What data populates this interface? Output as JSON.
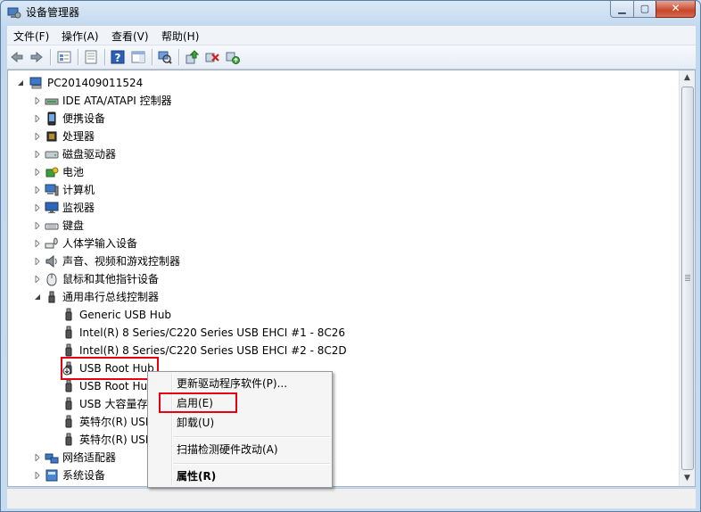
{
  "window": {
    "title": "设备管理器",
    "min_glyph": "▁",
    "max_glyph": "▢",
    "close_glyph": "✕"
  },
  "menu": [
    "文件(F)",
    "操作(A)",
    "查看(V)",
    "帮助(H)"
  ],
  "toolbar_icons": [
    "back-arrow-icon",
    "forward-arrow-icon",
    "device-view-icon",
    "properties-icon",
    "help-icon",
    "action-pane-icon",
    "scan-hardware-icon",
    "update-driver-icon",
    "uninstall-icon",
    "enable-device-icon"
  ],
  "tree": {
    "root": "PC201409011524",
    "categories": [
      {
        "label": "IDE ATA/ATAPI 控制器",
        "icon": "ide-controller-icon"
      },
      {
        "label": "便携设备",
        "icon": "portable-device-icon"
      },
      {
        "label": "处理器",
        "icon": "processor-icon"
      },
      {
        "label": "磁盘驱动器",
        "icon": "disk-drive-icon"
      },
      {
        "label": "电池",
        "icon": "battery-icon"
      },
      {
        "label": "计算机",
        "icon": "computer-icon"
      },
      {
        "label": "监视器",
        "icon": "monitor-icon"
      },
      {
        "label": "键盘",
        "icon": "keyboard-icon"
      },
      {
        "label": "人体学输入设备",
        "icon": "hid-icon"
      },
      {
        "label": "声音、视频和游戏控制器",
        "icon": "speaker-icon"
      },
      {
        "label": "鼠标和其他指针设备",
        "icon": "mouse-icon"
      },
      {
        "label": "通用串行总线控制器",
        "icon": "usb-icon"
      }
    ],
    "usb_children": [
      "Generic USB Hub",
      "Intel(R) 8 Series/C220 Series USB EHCI #1 - 8C26",
      "Intel(R) 8 Series/C220 Series USB EHCI #2 - 8C2D",
      "USB Root Hub",
      "USB Root Hu",
      "USB 大容量存",
      "英特尔(R) USI",
      "英特尔(R) USI"
    ],
    "after": [
      {
        "label": "网络适配器",
        "icon": "network-adapter-icon"
      },
      {
        "label": "系统设备",
        "icon": "system-device-icon"
      }
    ]
  },
  "context_menu": {
    "update_driver": "更新驱动程序软件(P)...",
    "enable": "启用(E)",
    "uninstall": "卸载(U)",
    "scan": "扫描检测硬件改动(A)",
    "properties": "属性(R)"
  },
  "colors": {
    "highlight_box": "#e60012",
    "usb_plug": "#555555"
  }
}
